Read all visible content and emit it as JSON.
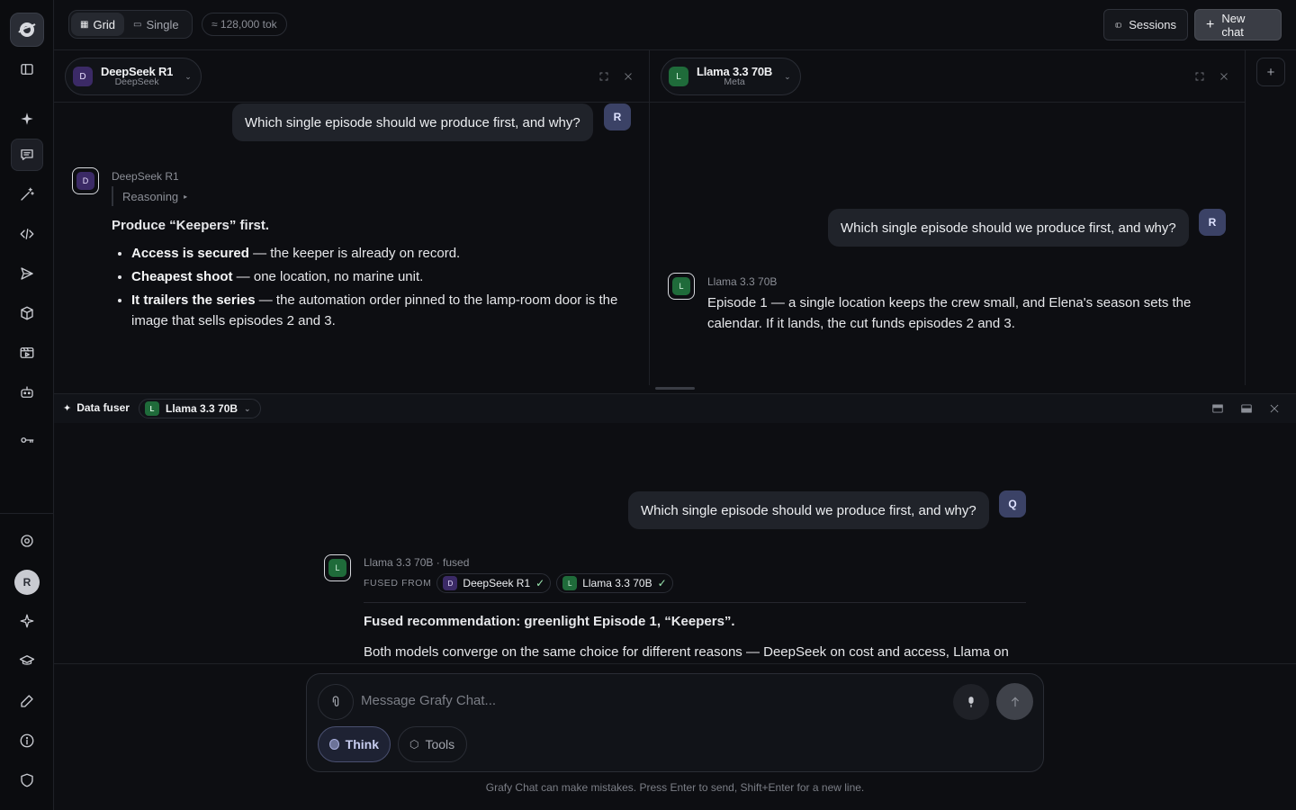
{
  "topbar": {
    "grid_label": "Grid",
    "single_label": "Single",
    "token_badge": "≈ 128,000 tok",
    "sessions_label": "Sessions",
    "new_chat_label": "New chat"
  },
  "panes": [
    {
      "model": "DeepSeek R1",
      "org": "DeepSeek",
      "avatar": "D",
      "user_avatar": "R",
      "user_message": "Which single episode should we produce first, and why?",
      "bot_label": "DeepSeek R1",
      "reasoning_label": "Reasoning",
      "heading": "Produce “Keepers” first.",
      "bullets": [
        {
          "bold": "Access is secured",
          "text": " — the keeper is already on record."
        },
        {
          "bold": "Cheapest shoot",
          "text": " — one location, no marine unit."
        },
        {
          "bold": "It trailers the series",
          "text": " — the automation order pinned to the lamp-room door is the image that sells episodes 2 and 3."
        }
      ]
    },
    {
      "model": "Llama 3.3 70B",
      "org": "Meta",
      "avatar": "L",
      "user_avatar": "R",
      "user_message": "Which single episode should we produce first, and why?",
      "bot_label": "Llama 3.3 70B",
      "answer": "Episode 1 — a single location keeps the crew small, and Elena's season sets the calendar. If it lands, the cut funds episodes 2 and 3."
    }
  ],
  "fuser": {
    "title": "Data fuser",
    "model": "Llama 3.3 70B",
    "model_avatar": "L",
    "user_avatar": "Q",
    "user_message": "Which single episode should we produce first, and why?",
    "bot_avatar": "L",
    "bot_label": "Llama 3.3 70B · fused",
    "fused_from_label": "FUSED FROM",
    "sources": [
      {
        "avatar": "D",
        "name": "DeepSeek R1",
        "check": "✓"
      },
      {
        "avatar": "L",
        "name": "Llama 3.3 70B",
        "check": "✓"
      }
    ],
    "heading": "Fused recommendation: greenlight Episode 1, “Keepers”.",
    "body": "Both models converge on the same choice for different reasons — DeepSeek on cost and access, Llama on"
  },
  "composer": {
    "placeholder": "Message Grafy Chat...",
    "think_label": "Think",
    "tools_label": "Tools",
    "footnote": "Grafy Chat can make mistakes. Press Enter to send, Shift+Enter for a new line."
  },
  "sidebar": {
    "user_initial": "R"
  }
}
